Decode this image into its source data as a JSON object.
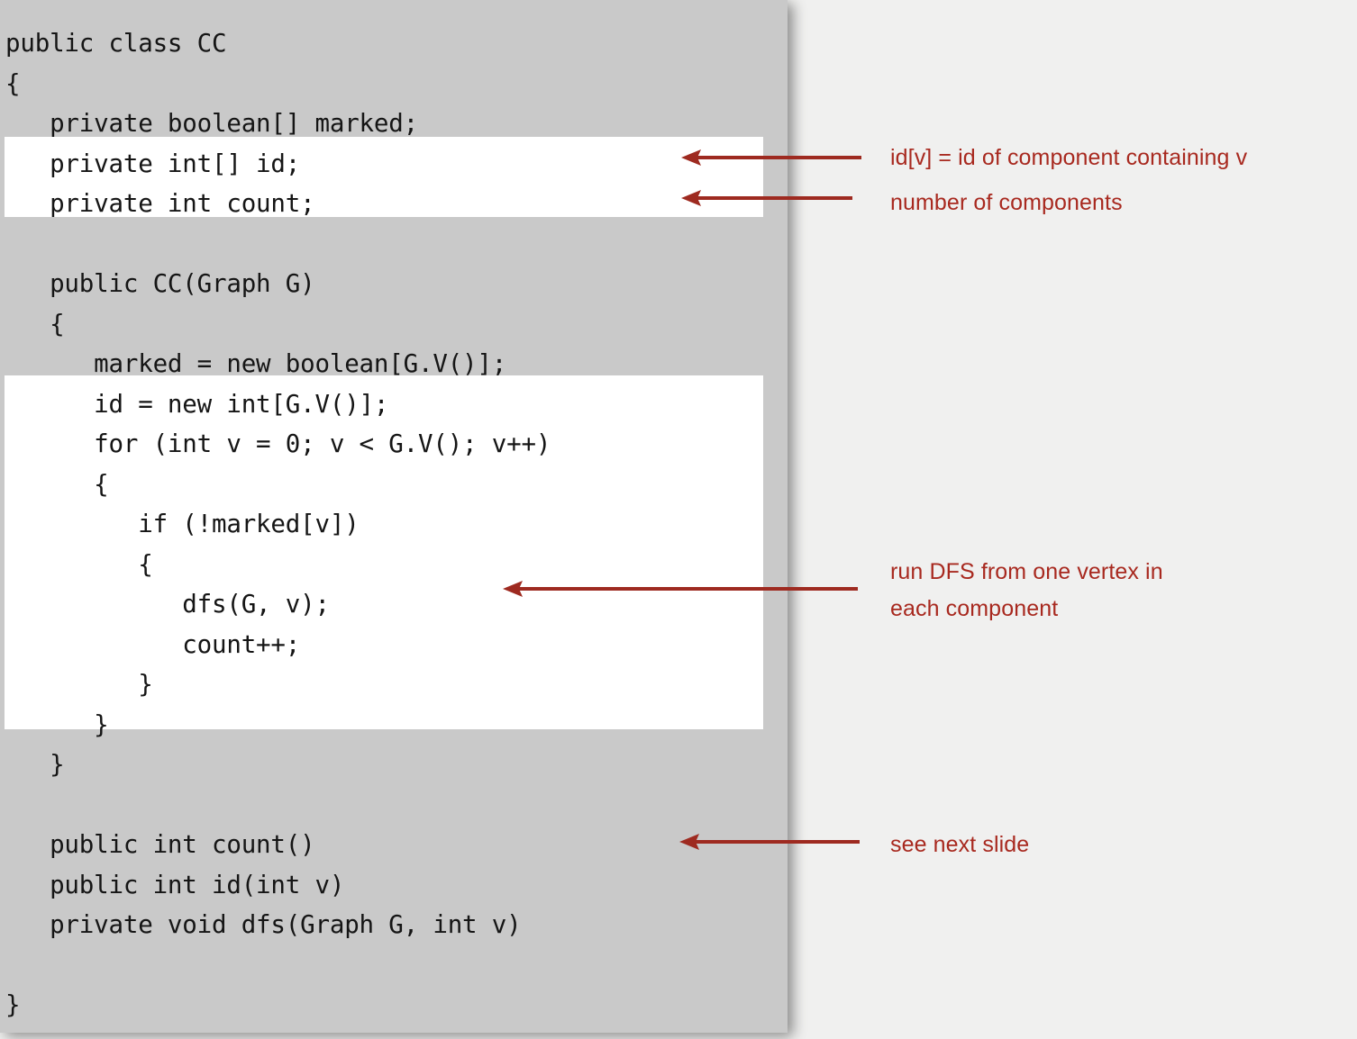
{
  "slide": {
    "background_color": "#f0f0ef",
    "panel_color": "#c9c9c9",
    "highlight_color": "#ffffff",
    "accent_color": "#a8291f"
  },
  "code": {
    "language": "java",
    "class_name": "CC",
    "listing": "public class CC\n{\n   private boolean[] marked;\n   private int[] id;\n   private int count;\n\n   public CC(Graph G)\n   {\n      marked = new boolean[G.V()];\n      id = new int[G.V()];\n      for (int v = 0; v < G.V(); v++)\n      {\n         if (!marked[v])\n         {\n            dfs(G, v);\n            count++;\n         }\n      }\n   }\n\n   public int count()\n   public int id(int v)\n   private void dfs(Graph G, int v)\n\n}"
  },
  "highlights": [
    {
      "name": "fields-highlight",
      "lines": [
        "private int[] id;",
        "private int count;"
      ]
    },
    {
      "name": "loop-highlight",
      "lines": [
        "id = new int[G.V()];",
        "for (int v = 0; v < G.V(); v++)",
        "{",
        "if (!marked[v])",
        "{",
        "dfs(G, v);",
        "count++;",
        "}",
        "}"
      ]
    }
  ],
  "annotations": [
    {
      "name": "id-annotation",
      "text": "id[v] = id of component containing v"
    },
    {
      "name": "count-annotation",
      "text": "number of components"
    },
    {
      "name": "dfs-annotation",
      "text": "run DFS from one vertex in\neach component"
    },
    {
      "name": "next-slide-annotation",
      "text": "see next slide"
    }
  ]
}
